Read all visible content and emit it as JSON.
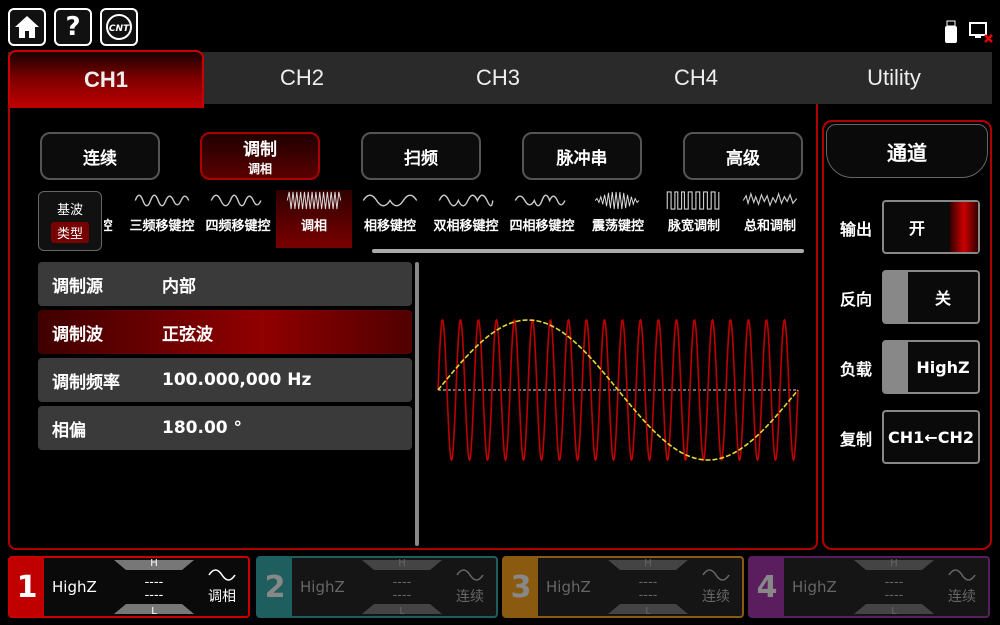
{
  "toolbar": {
    "home": "home-icon",
    "help": "?",
    "logo": "CNT"
  },
  "tabs": [
    "CH1",
    "CH2",
    "CH3",
    "CH4",
    "Utility"
  ],
  "modes": [
    {
      "label": "连续",
      "sub": ""
    },
    {
      "label": "调制",
      "sub": "调相"
    },
    {
      "label": "扫频",
      "sub": ""
    },
    {
      "label": "脉冲串",
      "sub": ""
    },
    {
      "label": "高级",
      "sub": ""
    }
  ],
  "type_button": {
    "line1": "基波",
    "line2": "类型"
  },
  "mod_types": [
    "控",
    "三频移键控",
    "四频移键控",
    "调相",
    "相移键控",
    "双相移键控",
    "四相移键控",
    "震荡键控",
    "脉宽调制",
    "总和调制"
  ],
  "params": [
    {
      "key": "调制源",
      "value": "内部"
    },
    {
      "key": "调制波",
      "value": "正弦波"
    },
    {
      "key": "调制频率",
      "value": "100.000,000 Hz"
    },
    {
      "key": "相偏",
      "value": "180.00 °"
    }
  ],
  "side": {
    "title": "通道",
    "rows": [
      {
        "label": "输出",
        "value": "开"
      },
      {
        "label": "反向",
        "value": "关"
      },
      {
        "label": "负载",
        "value": "HighZ"
      },
      {
        "label": "复制",
        "value": "CH1←CH2"
      }
    ]
  },
  "channels": [
    {
      "num": "1",
      "load": "HighZ",
      "h": "H",
      "l": "L",
      "v1": "----",
      "v2": "----",
      "mode": "调相",
      "color": "#c00000"
    },
    {
      "num": "2",
      "load": "HighZ",
      "h": "H",
      "l": "L",
      "v1": "----",
      "v2": "----",
      "mode": "连续",
      "color": "#1e5e5e"
    },
    {
      "num": "3",
      "load": "HighZ",
      "h": "H",
      "l": "L",
      "v1": "----",
      "v2": "----",
      "mode": "连续",
      "color": "#8a5a10"
    },
    {
      "num": "4",
      "load": "HighZ",
      "h": "H",
      "l": "L",
      "v1": "----",
      "v2": "----",
      "mode": "连续",
      "color": "#5a1e5e"
    }
  ]
}
